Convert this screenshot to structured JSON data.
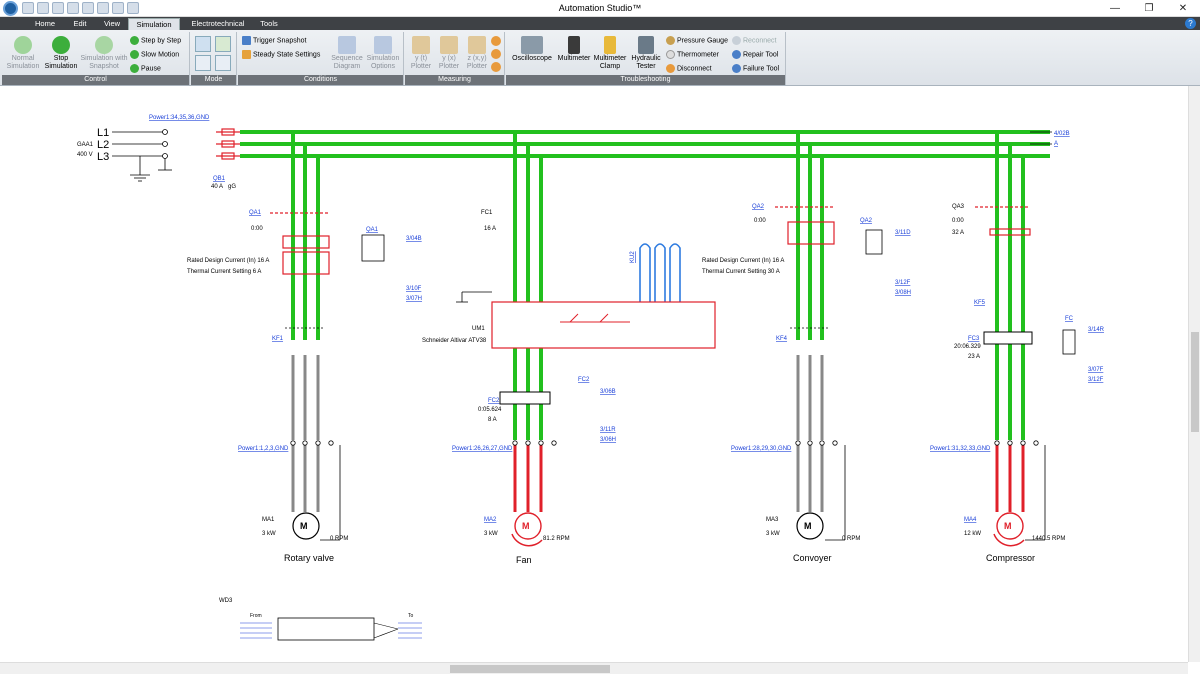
{
  "app_title": "Automation Studio™",
  "window_controls": {
    "minimize": "—",
    "maximize": "❐",
    "close": "✕"
  },
  "tabs": [
    {
      "label": "Home",
      "active": false
    },
    {
      "label": "Edit",
      "active": false
    },
    {
      "label": "View",
      "active": false
    },
    {
      "label": "Simulation",
      "active": true
    },
    {
      "label": "Electrotechnical",
      "active": false
    },
    {
      "label": "Tools",
      "active": false
    }
  ],
  "help_label": "?",
  "ribbon": {
    "control": {
      "label": "Control",
      "normal": "Normal Simulation",
      "stop": "Stop Simulation",
      "snapshot": "Simulation with Snapshot",
      "step": "Step by Step",
      "slow": "Slow Motion",
      "pause": "Pause"
    },
    "mode": {
      "label": "Mode"
    },
    "conditions": {
      "label": "Conditions",
      "trigger": "Trigger Snapshot",
      "steady": "Steady State Settings",
      "sequence": "Sequence Diagram",
      "options": "Simulation Options"
    },
    "measuring": {
      "label": "Measuring",
      "y_t": "y (t) Plotter",
      "y_x": "y (x) Plotter",
      "z_xy": "z (x,y) Plotter"
    },
    "troubleshooting": {
      "label": "Troubleshooting",
      "oscilloscope": "Oscilloscope",
      "multimeter": "Multimeter",
      "clamp": "Multimeter Clamp",
      "hydraulic": "Hydraulic Tester",
      "pressure": "Pressure Gauge",
      "thermometer": "Thermometer",
      "disconnect": "Disconnect",
      "reconnect": "Reconnect",
      "repair": "Repair Tool",
      "failure": "Failure Tool"
    }
  },
  "diagram": {
    "supply_ref": "Power1:34,35,36,GND",
    "supply_id": "GAA1",
    "supply_voltage": "400 V",
    "phases": [
      "L1",
      "L2",
      "L3"
    ],
    "out_ref_1": "4/02B",
    "out_ref_2": "A",
    "qb1": {
      "id": "QB1",
      "rating": "40 A",
      "type": "gG"
    },
    "branches": [
      {
        "breaker": "QA1",
        "time": "0:00",
        "design": "Rated Design Current (In) 16 A",
        "thermal": "Thermal Current Setting  6 A",
        "aux": "QA1",
        "aux_ref": "3/04B",
        "ref2": "3/10F",
        "ref3": "3/07H",
        "contactor": "KF1",
        "power_ref": "Power1:1,2,3,GND",
        "motor_id": "MA1",
        "motor_power": "3 kW",
        "speed": "0 RPM",
        "name": "Rotary valve"
      },
      {
        "breaker": "FC1",
        "rating": "16 A",
        "drive_id": "UM1",
        "drive_name": "Schneider Altivar ATV38",
        "fc": "FC2",
        "fc_time": "0:05.624",
        "fc_current": "8 A",
        "aux": "FC2",
        "aux_ref": "3/06B",
        "ref2": "3/11R",
        "ref3": "3/06H",
        "power_ref": "Power1:26,26,27,GND",
        "motor_id": "MA2",
        "motor_power": "3 kW",
        "speed": "81.2 RPM",
        "name": "Fan",
        "ku": "KU2"
      },
      {
        "breaker": "QA2",
        "time": "0:00",
        "design": "Rated Design Current (In) 16 A",
        "thermal": "Thermal Current Setting  30 A",
        "aux": "QA2",
        "aux_ref": "3/11D",
        "ref2": "3/12F",
        "ref3": "3/08H",
        "contactor": "KF4",
        "power_ref": "Power1:28,29,30,GND",
        "motor_id": "MA3",
        "motor_power": "3 kW",
        "speed": "0 RPM",
        "name": "Convoyer"
      },
      {
        "breaker": "QA3",
        "time": "0:00",
        "current": "32 A",
        "contactor": "KF5",
        "fc": "FC3",
        "fc_time": "20:06.329",
        "fc_current": "23 A",
        "aux": "FC",
        "aux_ref": "3/14R",
        "ref2": "3/07F",
        "ref3": "3/12F",
        "power_ref": "Power1:31,32,33,GND",
        "motor_id": "MA4",
        "motor_power": "12 kW",
        "speed": "1440.5 RPM",
        "name": "Compressor"
      }
    ],
    "wd_id": "WD3",
    "wd_from": "From",
    "wd_to": "To"
  }
}
